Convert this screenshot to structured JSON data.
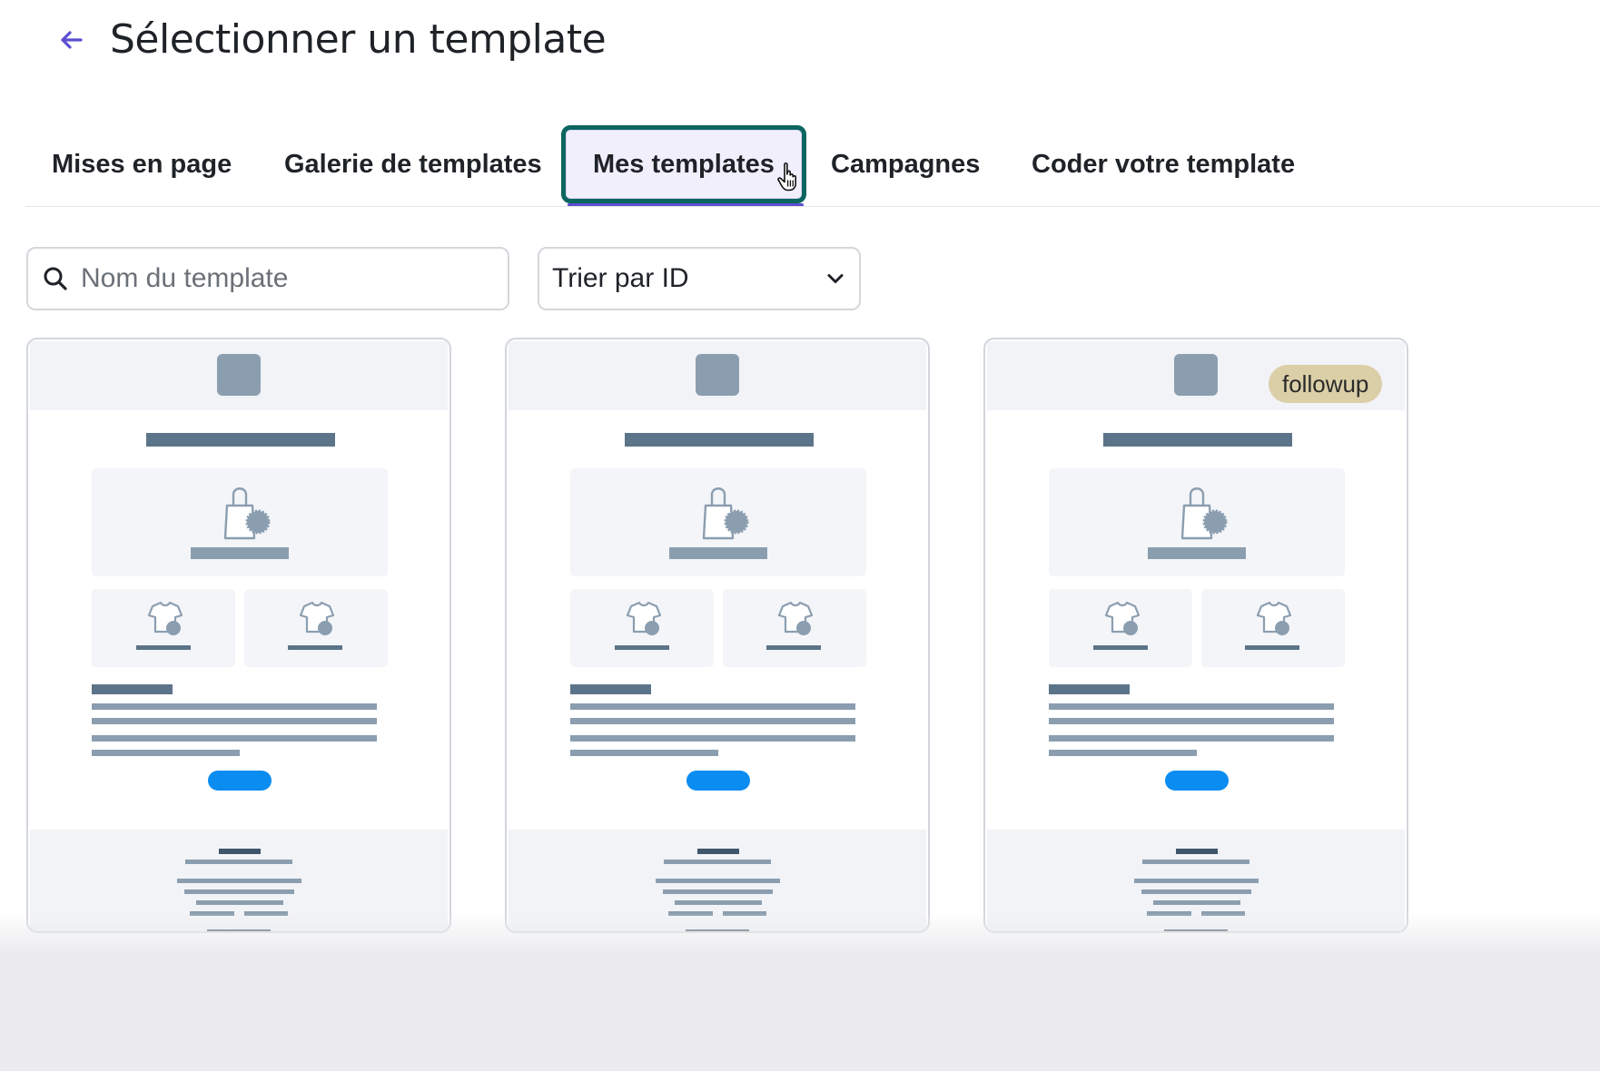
{
  "header": {
    "title": "Sélectionner un template"
  },
  "tabs": [
    {
      "label": "Mises en page",
      "active": false
    },
    {
      "label": "Galerie de templates",
      "active": false
    },
    {
      "label": "Mes templates",
      "active": true
    },
    {
      "label": "Campagnes",
      "active": false
    },
    {
      "label": "Coder votre template",
      "active": false
    }
  ],
  "search": {
    "placeholder": "Nom du template",
    "value": ""
  },
  "sort": {
    "selected": "Trier par ID"
  },
  "cards": [
    {
      "tag": ""
    },
    {
      "tag": ""
    },
    {
      "tag": "followup"
    }
  ],
  "colors": {
    "accent": "#5b4fcf",
    "focus_ring": "#0b6660",
    "active_tab_bg": "#f1effc",
    "preview_header": "#f2f3f7",
    "preview_block": "#f4f5f8",
    "preview_logo": "#8b9eb0",
    "preview_title_bar": "#5c7489",
    "preview_text_line": "#8b9eb0",
    "preview_button": "#0a8cf0",
    "tag_bg": "#dbcfa8"
  },
  "icons": {
    "back": "arrow-left-icon",
    "search": "search-icon",
    "sort": "chevron-down-icon",
    "cursor": "hand-pointer-icon"
  }
}
